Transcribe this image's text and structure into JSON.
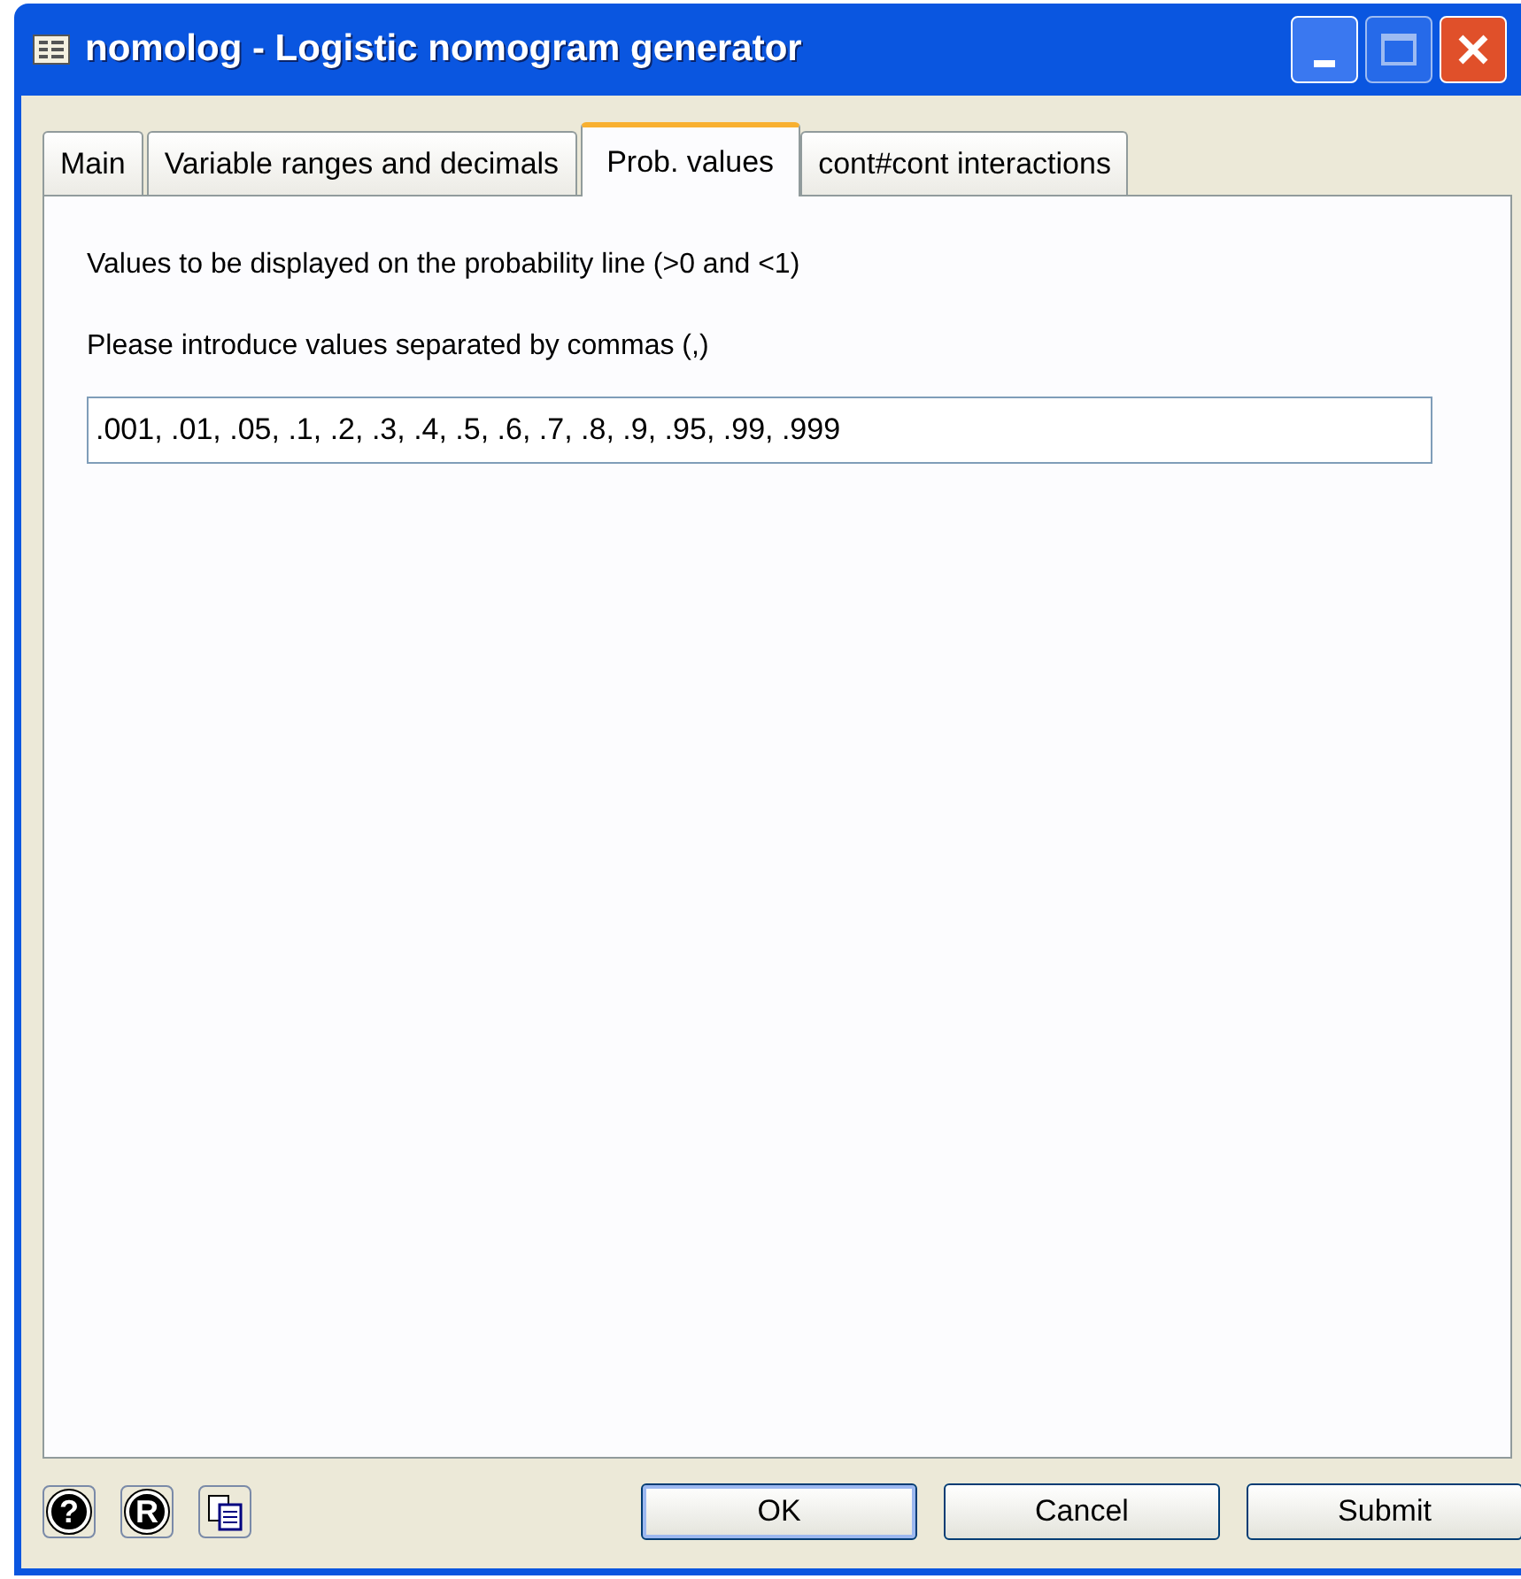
{
  "window": {
    "title": "nomolog - Logistic nomogram generator"
  },
  "tabs": [
    {
      "label": "Main",
      "selected": false
    },
    {
      "label": "Variable ranges and decimals",
      "selected": false
    },
    {
      "label": "Prob. values",
      "selected": true
    },
    {
      "label": "cont#cont interactions",
      "selected": false
    }
  ],
  "panel": {
    "description": "Values to be displayed on the probability line (>0 and <1)",
    "instruction": "Please introduce values separated by commas (,)",
    "values_field": {
      "value": ".001, .01, .05, .1, .2, .3, .4, .5, .6, .7, .8, .9, .95, .99, .999"
    }
  },
  "icon_buttons": [
    {
      "kind": "glyph",
      "glyph": "?"
    },
    {
      "kind": "glyph",
      "glyph": "R"
    },
    {
      "kind": "copy"
    }
  ],
  "buttons": [
    {
      "label": "OK",
      "default": true
    },
    {
      "label": "Cancel",
      "default": false
    },
    {
      "label": "Submit",
      "default": false
    }
  ]
}
